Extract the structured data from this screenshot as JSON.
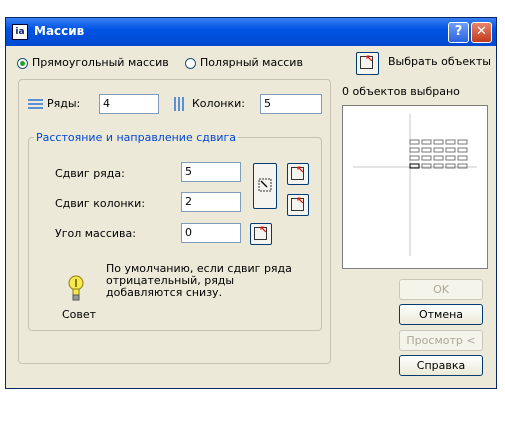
{
  "window": {
    "title": "Массив",
    "app_icon_text": "ia",
    "help_label": "?",
    "close_label": "✕"
  },
  "mode": {
    "rect_label": "Прямоугольный массив",
    "polar_label": "Полярный массив",
    "selected": "rect"
  },
  "select_objects": {
    "label": "Выбрать объекты",
    "status": "0 объектов выбрано"
  },
  "counts": {
    "rows_label": "Ряды:",
    "rows_value": "4",
    "cols_label": "Колонки:",
    "cols_value": "5"
  },
  "offset_group": {
    "legend": "Расстояние и направление сдвига",
    "row_offset_label": "Сдвиг ряда:",
    "row_offset_value": "5",
    "col_offset_label": "Сдвиг колонки:",
    "col_offset_value": "2",
    "angle_label": "Угол массива:",
    "angle_value": "0"
  },
  "tip": {
    "title": "Совет",
    "text": "По умолчанию, если сдвиг ряда отрицательный, ряды добавляются снизу."
  },
  "buttons": {
    "ok": "OK",
    "cancel": "Отмена",
    "preview": "Просмотр <",
    "help": "Справка"
  },
  "preview_grid": {
    "rows": 4,
    "cols": 5
  }
}
